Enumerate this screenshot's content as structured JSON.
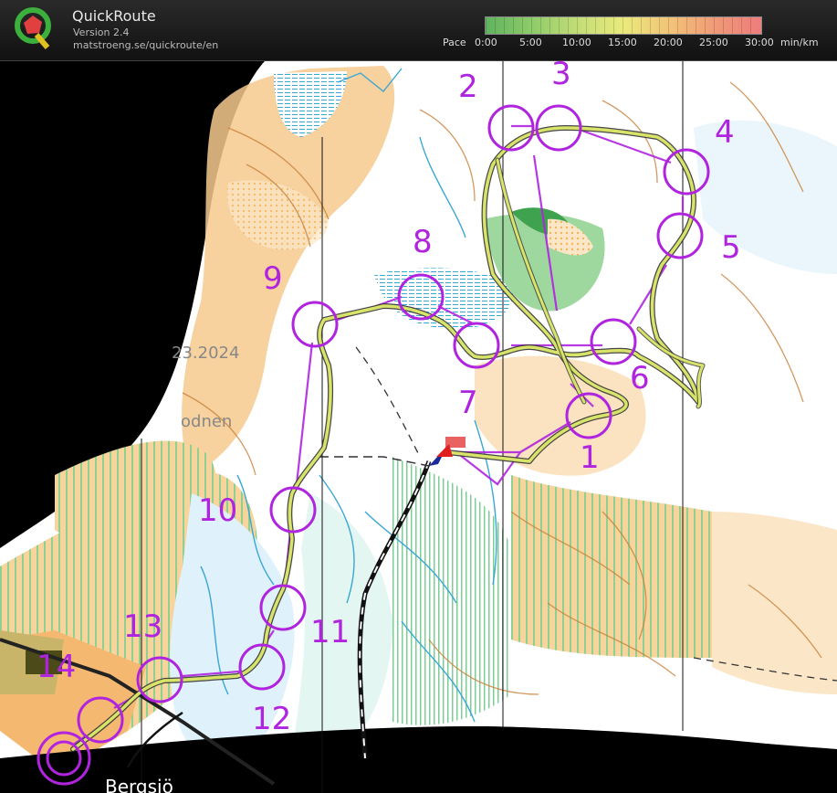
{
  "app": {
    "title": "QuickRoute",
    "version": "Version 2.4",
    "url": "matstroeng.se/quickroute/en"
  },
  "pace_legend": {
    "label": "Pace",
    "ticks": [
      "0:00",
      "5:00",
      "10:00",
      "15:00",
      "20:00",
      "25:00",
      "30:00"
    ],
    "unit": "min/km",
    "colors": [
      "#5fb35f",
      "#8ecb6a",
      "#c3dd77",
      "#eaea7c",
      "#f2c478",
      "#f09a78",
      "#ee7c7c"
    ]
  },
  "map": {
    "map_text": [
      "23.2024",
      "odnen",
      "Bergsjö"
    ],
    "route_color": "#d8e36a",
    "control_color": "#b024e0",
    "controls": [
      {
        "label": "1"
      },
      {
        "label": "2"
      },
      {
        "label": "3"
      },
      {
        "label": "4"
      },
      {
        "label": "5"
      },
      {
        "label": "6"
      },
      {
        "label": "7"
      },
      {
        "label": "8"
      },
      {
        "label": "9"
      },
      {
        "label": "10"
      },
      {
        "label": "11"
      },
      {
        "label": "12"
      },
      {
        "label": "13"
      },
      {
        "label": "14"
      }
    ]
  }
}
